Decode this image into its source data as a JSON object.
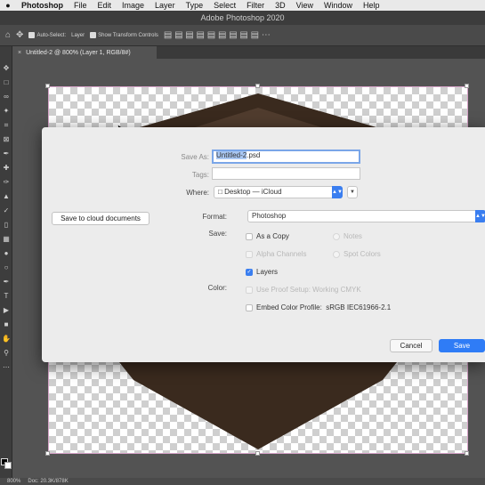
{
  "menubar": {
    "items": [
      "Photoshop",
      "File",
      "Edit",
      "Image",
      "Layer",
      "Type",
      "Select",
      "Filter",
      "3D",
      "View",
      "Window",
      "Help"
    ]
  },
  "titlebar": {
    "title": "Adobe Photoshop 2020"
  },
  "options": {
    "auto_select": "Auto-Select:",
    "layer": "Layer",
    "show_transform": "Show Transform Controls"
  },
  "tab": {
    "title": "Untitled-2 @ 800% (Layer 1, RGB/8#)"
  },
  "status": {
    "zoom": "800%",
    "doc": "Doc: 20.3K/878K"
  },
  "dialog": {
    "save_as_label": "Save As:",
    "save_as_value": "Untitled-2",
    "save_as_ext": ".psd",
    "tags_label": "Tags:",
    "where_label": "Where:",
    "where_value": "Desktop — iCloud",
    "cloud_button": "Save to cloud documents",
    "format_label": "Format:",
    "format_value": "Photoshop",
    "save_label": "Save:",
    "as_a_copy": "As a Copy",
    "notes": "Notes",
    "alpha_channels": "Alpha Channels",
    "spot_colors": "Spot Colors",
    "layers": "Layers",
    "color_label": "Color:",
    "use_proof": "Use Proof Setup:  Working CMYK",
    "embed_profile": "Embed Color Profile:",
    "profile_value": "sRGB IEC61966-2.1",
    "cancel": "Cancel",
    "save": "Save"
  }
}
